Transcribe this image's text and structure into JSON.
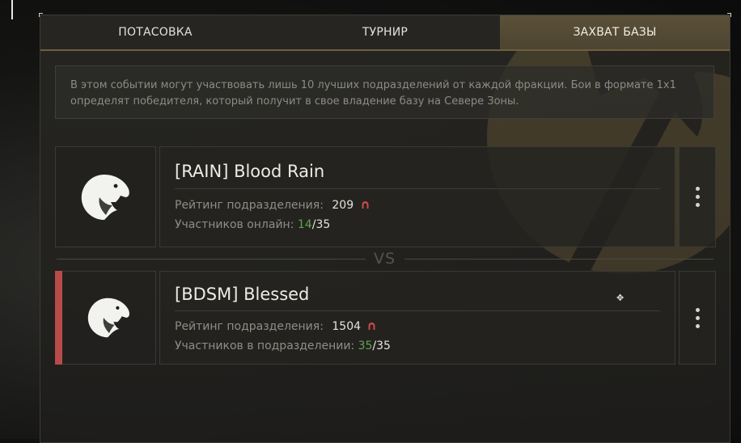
{
  "tabs": [
    {
      "label": "ПОТАСОВКА",
      "active": false
    },
    {
      "label": "ТУРНИР",
      "active": false
    },
    {
      "label": "ЗАХВАТ БАЗЫ",
      "active": true
    }
  ],
  "info_text": "В этом событии могут участвовать лишь 10 лучших подразделений от каждой фракции. Бои в формате 1x1 определят победителя, который получит в свое владение базу на Севере Зоны.",
  "vs_label": "VS",
  "units": [
    {
      "name": "[RAIN] Blood Rain",
      "rating_label": "Рейтинг подразделения:",
      "rating_value": "209",
      "members_label": "Участников онлайн:",
      "members_current": "14",
      "members_sep": "/",
      "members_total": "35"
    },
    {
      "name": "[BDSM] Blessed",
      "rating_label": "Рейтинг подразделения:",
      "rating_value": "1504",
      "members_label": "Участников в подразделении:",
      "members_current": "35",
      "members_sep": "/",
      "members_total": "35"
    }
  ],
  "colors": {
    "accent_tab": "#5b5139",
    "highlight_bar": "#b84a4a",
    "members_green": "#5fa450",
    "rank_icon": "#c84a4a"
  },
  "icons": [
    "eagle-emblem-icon",
    "rank-icon",
    "more-menu-icon",
    "cursor-icon"
  ]
}
